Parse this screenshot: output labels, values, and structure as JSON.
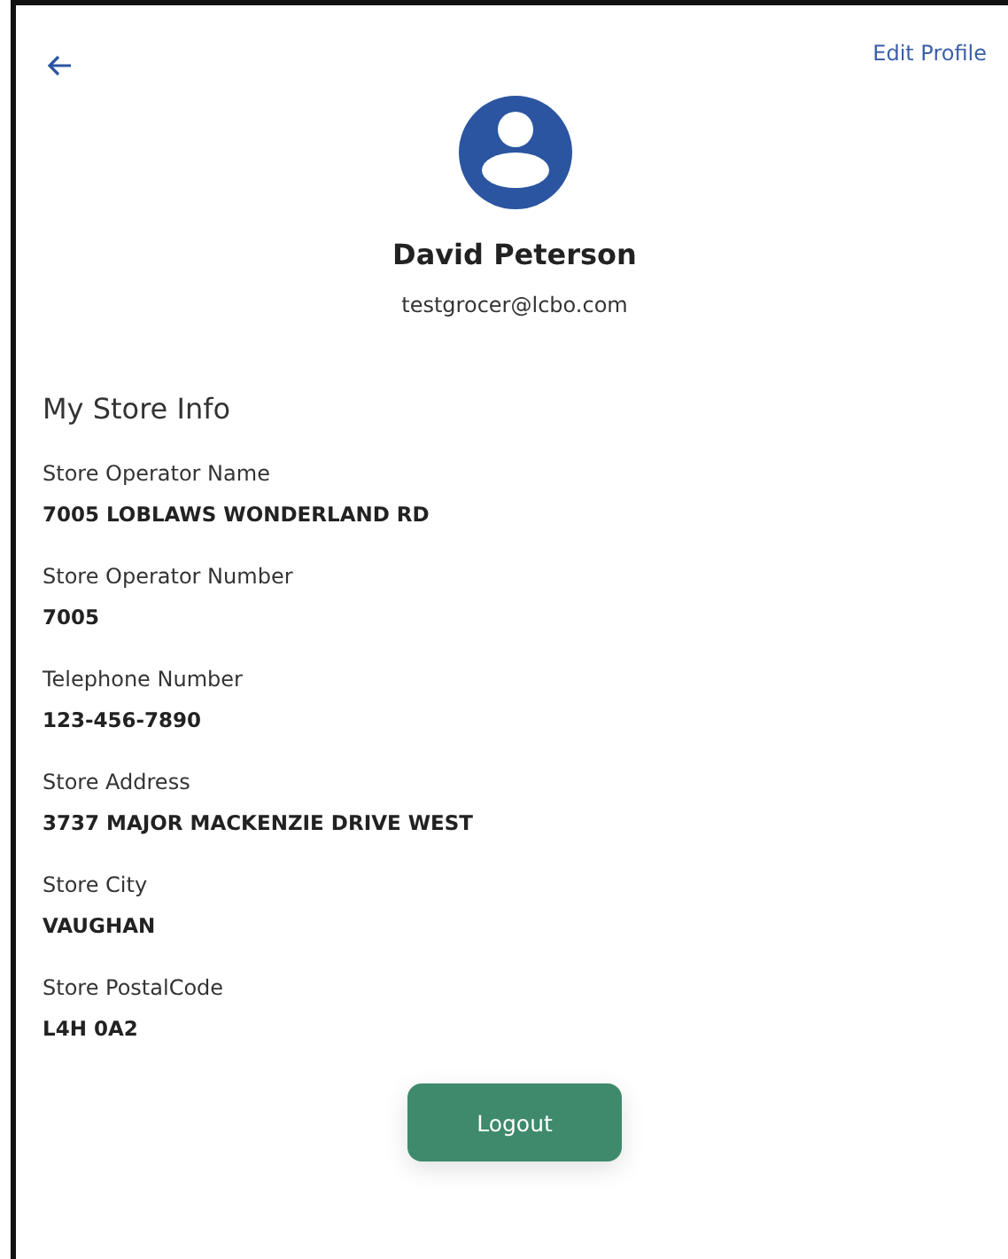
{
  "header": {
    "edit_link": "Edit Profile"
  },
  "profile": {
    "name": "David Peterson",
    "email": "testgrocer@lcbo.com"
  },
  "section_title": "My Store Info",
  "fields": [
    {
      "label": "Store Operator Name",
      "value": "7005 LOBLAWS WONDERLAND RD"
    },
    {
      "label": "Store Operator Number",
      "value": "7005"
    },
    {
      "label": "Telephone Number",
      "value": "123-456-7890"
    },
    {
      "label": "Store Address",
      "value": "3737 MAJOR MACKENZIE DRIVE WEST"
    },
    {
      "label": "Store City",
      "value": "VAUGHAN"
    },
    {
      "label": "Store PostalCode",
      "value": "L4H 0A2"
    }
  ],
  "logout_button": "Logout"
}
